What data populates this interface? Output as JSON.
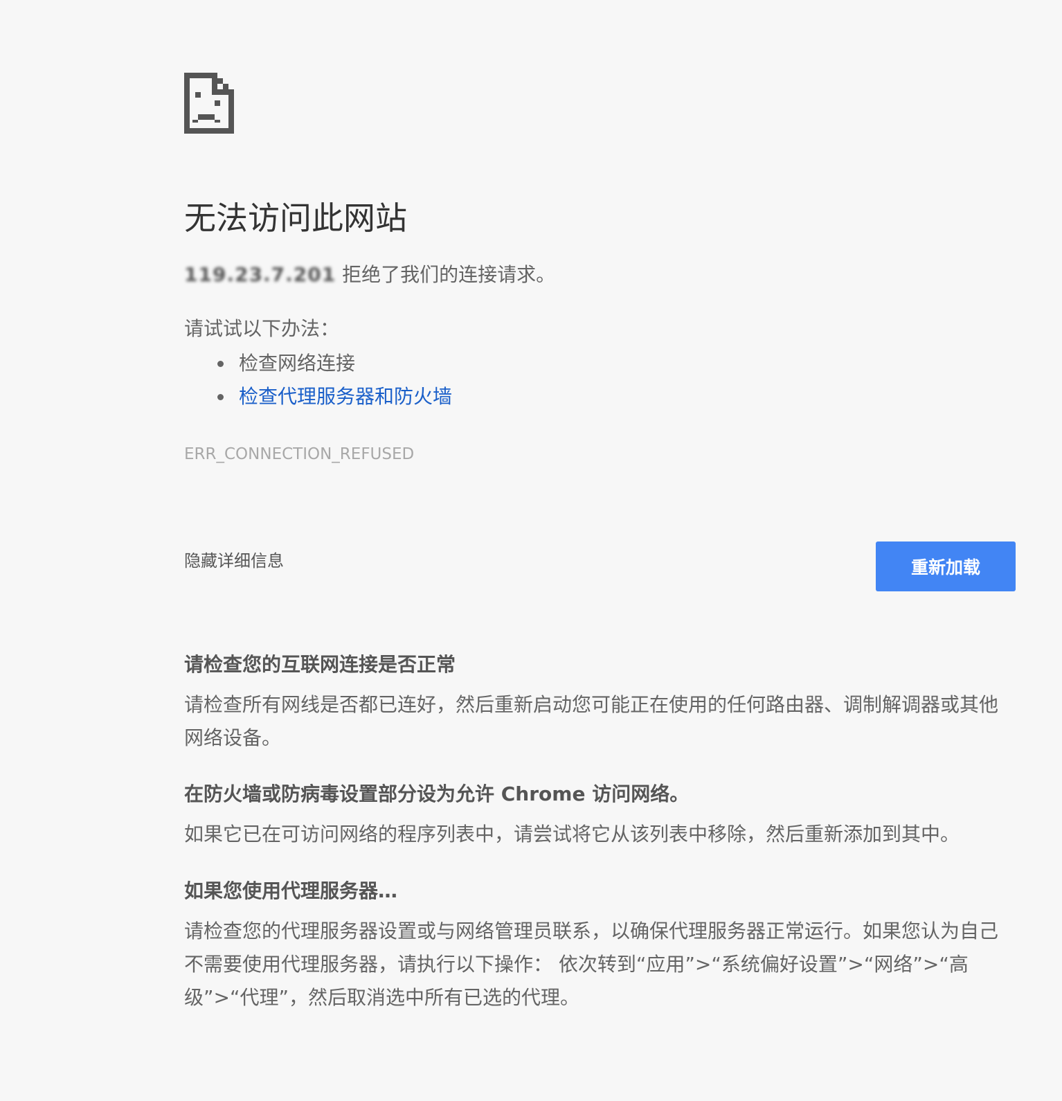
{
  "page": {
    "title": "无法访问此网站",
    "host": "119.23.7.201",
    "summary_suffix": " 拒绝了我们的连接请求。",
    "suggestions_heading": "请试试以下办法：",
    "suggestions": [
      {
        "label": "检查网络连接",
        "link": false
      },
      {
        "label": "检查代理服务器和防火墙",
        "link": true
      }
    ],
    "error_code": "ERR_CONNECTION_REFUSED",
    "details_toggle": "隐藏详细信息",
    "reload_label": "重新加载"
  },
  "details": [
    {
      "heading": "请检查您的互联网连接是否正常",
      "body": "请检查所有网线是否都已连好，然后重新启动您可能正在使用的任何路由器、调制解调器或其他网络设备。"
    },
    {
      "heading": "在防火墙或防病毒设置部分设为允许 Chrome 访问网络。",
      "body": "如果它已在可访问网络的程序列表中，请尝试将它从该列表中移除，然后重新添加到其中。"
    },
    {
      "heading": "如果您使用代理服务器…",
      "body": "请检查您的代理服务器设置或与网络管理员联系，以确保代理服务器正常运行。如果您认为自己不需要使用代理服务器，请执行以下操作： 依次转到“应用”>“系统偏好设置”>“网络”>“高级”>“代理”，然后取消选中所有已选的代理。"
    }
  ],
  "colors": {
    "background": "#f7f7f7",
    "accent_button": "#4285f4",
    "link": "#1a5fc9",
    "error_code": "#a8a8a8"
  },
  "icons": {
    "error": "sad-page-icon"
  }
}
